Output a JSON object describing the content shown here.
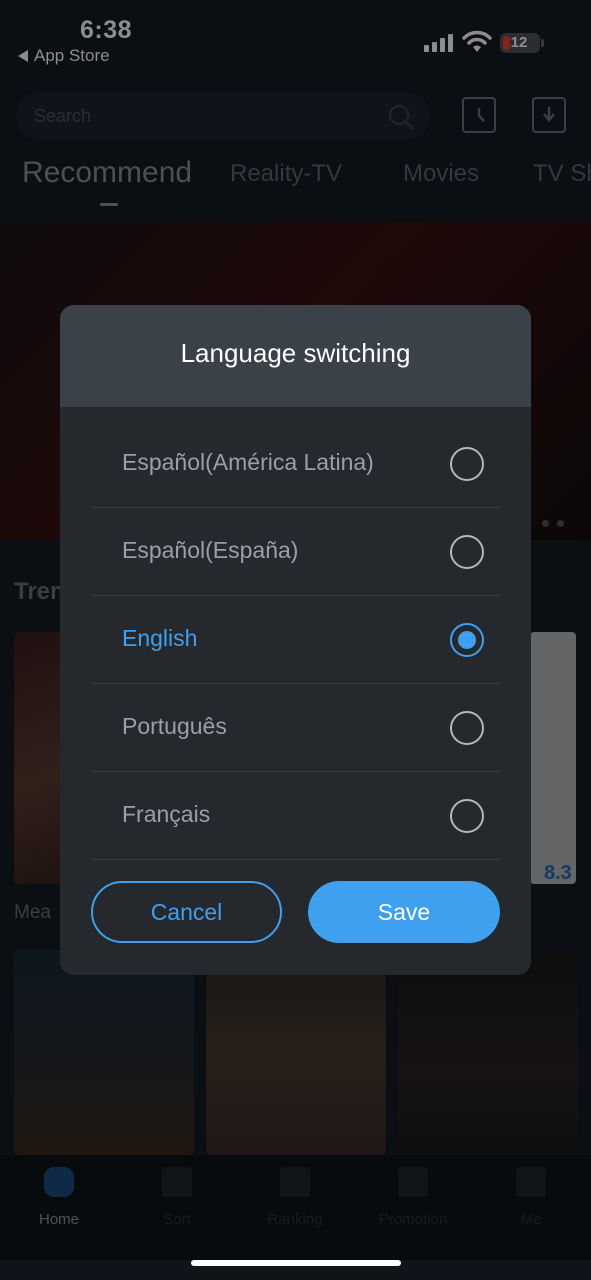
{
  "status_bar": {
    "time": "6:38",
    "back_app": "App Store",
    "battery": "12",
    "signal_icon": "cellular-signal-icon",
    "wifi_icon": "wifi-icon"
  },
  "search": {
    "placeholder": "Search"
  },
  "header_icons": {
    "history": "clock-icon",
    "download": "download-icon"
  },
  "tabs": [
    {
      "label": "Recommend",
      "active": true
    },
    {
      "label": "Reality-TV"
    },
    {
      "label": "Movies"
    },
    {
      "label": "TV Sh"
    }
  ],
  "sections": {
    "trending_partial": "Tren",
    "poster_title_partial": "Mea",
    "rating": "8.3"
  },
  "bottom_nav": [
    {
      "label": "Home",
      "icon": "home-icon",
      "active": true
    },
    {
      "label": "Sort",
      "icon": "grid-icon"
    },
    {
      "label": "Ranking",
      "icon": "bar-chart-icon"
    },
    {
      "label": "Promotion",
      "icon": "gift-icon"
    },
    {
      "label": "Me",
      "icon": "person-icon"
    }
  ],
  "dialog": {
    "title": "Language switching",
    "options": [
      {
        "label": "Español(América Latina)",
        "selected": false
      },
      {
        "label": "Español(España)",
        "selected": false
      },
      {
        "label": "English",
        "selected": true
      },
      {
        "label": "Português",
        "selected": false
      },
      {
        "label": "Français",
        "selected": false
      }
    ],
    "cancel_label": "Cancel",
    "save_label": "Save"
  },
  "colors": {
    "accent": "#3ea0ef",
    "dialog_bg": "#25282d",
    "dialog_header": "#3a4149"
  }
}
